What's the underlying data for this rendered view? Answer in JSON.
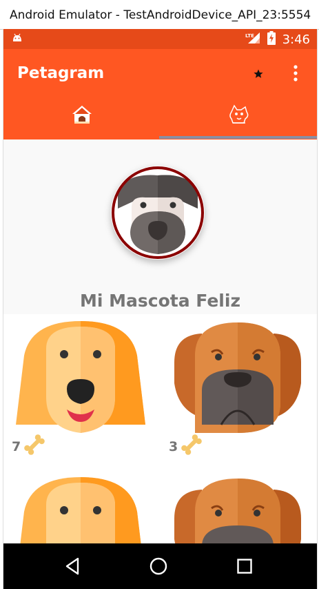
{
  "window": {
    "title": "Android Emulator - TestAndroidDevice_API_23:5554"
  },
  "status_bar": {
    "time": "3:46",
    "network": "LTE",
    "icons": [
      "android-debug-icon",
      "lte-signal-icon",
      "battery-charging-icon"
    ]
  },
  "app_bar": {
    "title": "Petagram",
    "actions": [
      "star-icon",
      "overflow-menu-icon"
    ]
  },
  "tabs": [
    {
      "icon": "doghouse-icon",
      "selected": true
    },
    {
      "icon": "dog-profile-icon",
      "selected": false
    }
  ],
  "profile": {
    "name": "Mi Mascota Feliz"
  },
  "pets": [
    {
      "likes": "7",
      "icon": "bone-icon",
      "breed_style": "golden-dog"
    },
    {
      "likes": "3",
      "icon": "bone-icon",
      "breed_style": "brown-dog"
    },
    {
      "likes": "",
      "icon": "bone-icon",
      "breed_style": "golden-dog"
    },
    {
      "likes": "",
      "icon": "bone-icon",
      "breed_style": "brown-dog"
    }
  ],
  "nav_bar": {
    "buttons": [
      "back-icon",
      "home-icon",
      "recents-icon"
    ]
  },
  "colors": {
    "status_bar": "#e64a19",
    "primary": "#ff5722",
    "tab_indicator": "#8a8fa3",
    "avatar_border": "#8b0000"
  }
}
